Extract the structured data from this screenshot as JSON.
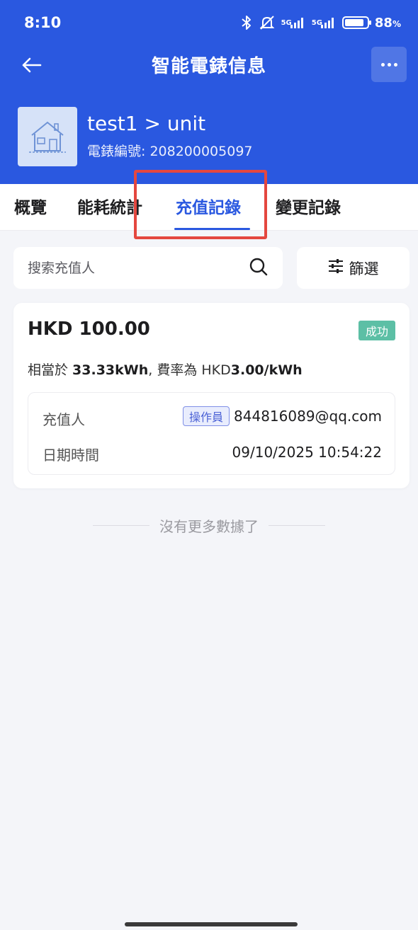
{
  "status_bar": {
    "time": "8:10",
    "network1": "5G",
    "network2": "5G",
    "battery_percent": "88",
    "battery_unit": "%"
  },
  "nav": {
    "title": "智能電錶信息"
  },
  "meter": {
    "name": "test1 > unit",
    "number_label": "電錶編號: 208200005097"
  },
  "tabs": [
    {
      "label": "概覽"
    },
    {
      "label": "能耗統計"
    },
    {
      "label": "充值記錄"
    },
    {
      "label": "變更記錄"
    }
  ],
  "search": {
    "placeholder": "搜索充值人"
  },
  "filter": {
    "label": "篩選"
  },
  "record": {
    "amount": "HKD 100.00",
    "status": "成功",
    "summary_prefix": "相當於 ",
    "summary_kwh": "33.33kWh",
    "summary_mid": ", 費率為 HKD",
    "summary_rate": "3.00/kWh",
    "recharger_label": "充值人",
    "recharger_role": "操作員",
    "recharger_value": "844816089@qq.com",
    "datetime_label": "日期時間",
    "datetime_value": "09/10/2025 10:54:22"
  },
  "list_footer": "沒有更多數據了",
  "colors": {
    "primary": "#2A58E0",
    "success": "#5CBFA5",
    "highlight": "#E4473F"
  }
}
